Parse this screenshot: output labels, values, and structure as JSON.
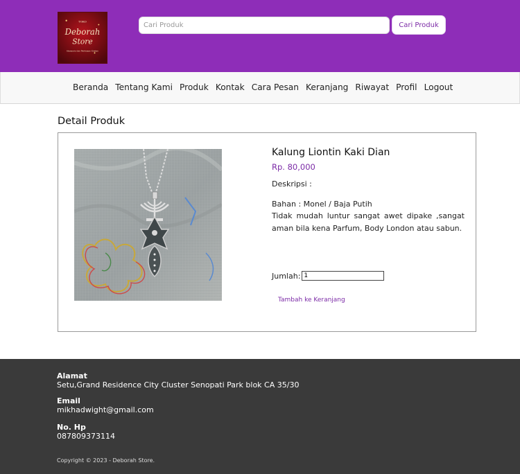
{
  "header": {
    "logo": {
      "top_text": "TOKO",
      "title_line1": "Deborah",
      "title_line2": "Store",
      "tagline": "Aksesoris dan Perhiasan Kristen"
    },
    "search": {
      "placeholder": "Cari Produk",
      "button_label": "Cari Produk"
    },
    "colors": {
      "brand": "#8e2db8",
      "accent": "#7b2aa6"
    }
  },
  "nav": {
    "items": [
      {
        "label": "Beranda"
      },
      {
        "label": "Tentang Kami"
      },
      {
        "label": "Produk"
      },
      {
        "label": "Kontak"
      },
      {
        "label": "Cara Pesan"
      },
      {
        "label": "Keranjang"
      },
      {
        "label": "Riwayat"
      },
      {
        "label": "Profil"
      },
      {
        "label": "Logout"
      }
    ]
  },
  "page": {
    "title": "Detail Produk"
  },
  "product": {
    "name": "Kalung Liontin Kaki Dian",
    "price": "Rp. 80,000",
    "description_label": "Deskripsi :",
    "material": "Bahan : Monel / Baja Putih",
    "description": "Tidak mudah luntur sangat awet dipake ,sangat aman bila kena Parfum, Body London atau sabun.",
    "quantity_label": "Jumlah:",
    "quantity_value": "1",
    "add_to_cart_label": "Tambah ke Keranjang"
  },
  "footer": {
    "address_label": "Alamat",
    "address": "Setu,Grand Residence City Cluster Senopati Park blok CA 35/30",
    "email_label": "Email",
    "email": "mikhadwight@gmail.com",
    "phone_label": "No. Hp",
    "phone": "087809373114",
    "copyright": "Copyright © 2023 - Deborah Store."
  }
}
